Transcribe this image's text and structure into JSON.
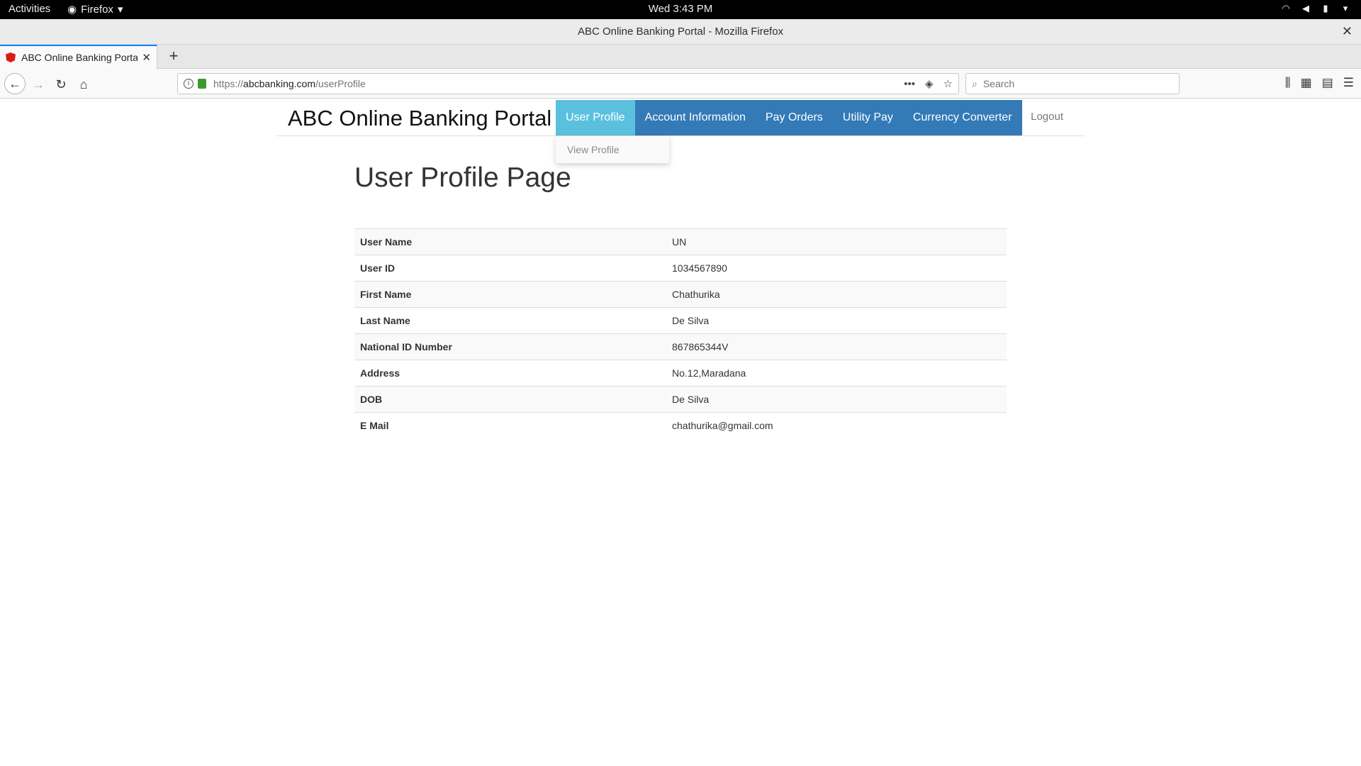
{
  "system": {
    "activities": "Activities",
    "app_menu": "Firefox",
    "clock": "Wed  3:43 PM"
  },
  "window": {
    "title": "ABC Online Banking Portal - Mozilla Firefox"
  },
  "tabs": [
    {
      "title": "ABC Online Banking Portal"
    }
  ],
  "url": {
    "scheme": "https://",
    "host": "abcbanking.com",
    "path": "/userProfile"
  },
  "search": {
    "placeholder": "Search"
  },
  "site": {
    "brand": "ABC Online Banking Portal",
    "nav": [
      {
        "label": "User Profile"
      },
      {
        "label": "Account Information"
      },
      {
        "label": "Pay Orders"
      },
      {
        "label": "Utility Pay"
      },
      {
        "label": "Currency Converter"
      }
    ],
    "logout": "Logout",
    "dropdown_item": "View Profile"
  },
  "profile": {
    "heading": "User Profile Page",
    "rows": [
      {
        "label": "User Name",
        "value": "UN"
      },
      {
        "label": "User ID",
        "value": "1034567890"
      },
      {
        "label": "First Name",
        "value": "Chathurika"
      },
      {
        "label": "Last Name",
        "value": "De Silva"
      },
      {
        "label": "National ID Number",
        "value": "867865344V"
      },
      {
        "label": "Address",
        "value": "No.12,Maradana"
      },
      {
        "label": "DOB",
        "value": "De Silva"
      },
      {
        "label": "E Mail",
        "value": "chathurika@gmail.com"
      }
    ]
  }
}
